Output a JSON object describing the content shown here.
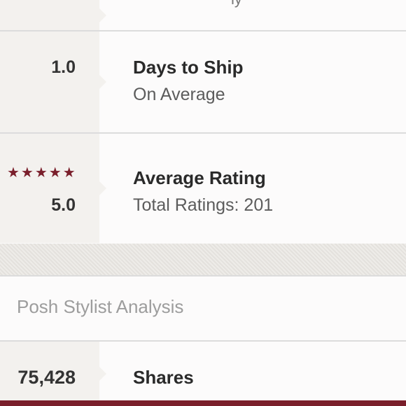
{
  "top_partial": {
    "text": "ly"
  },
  "days_to_ship": {
    "value": "1.0",
    "title": "Days to Ship",
    "subtitle": "On Average"
  },
  "average_rating": {
    "stars": "★★★★★",
    "rating_value": 5,
    "value": "5.0",
    "title": "Average Rating",
    "subtitle": "Total Ratings: 201"
  },
  "stylist_analysis": {
    "heading": "Posh Stylist Analysis"
  },
  "shares": {
    "value": "75,428",
    "title": "Shares"
  },
  "colors": {
    "accent": "#7a1f2b",
    "left_panel": "#f3f1ee"
  }
}
